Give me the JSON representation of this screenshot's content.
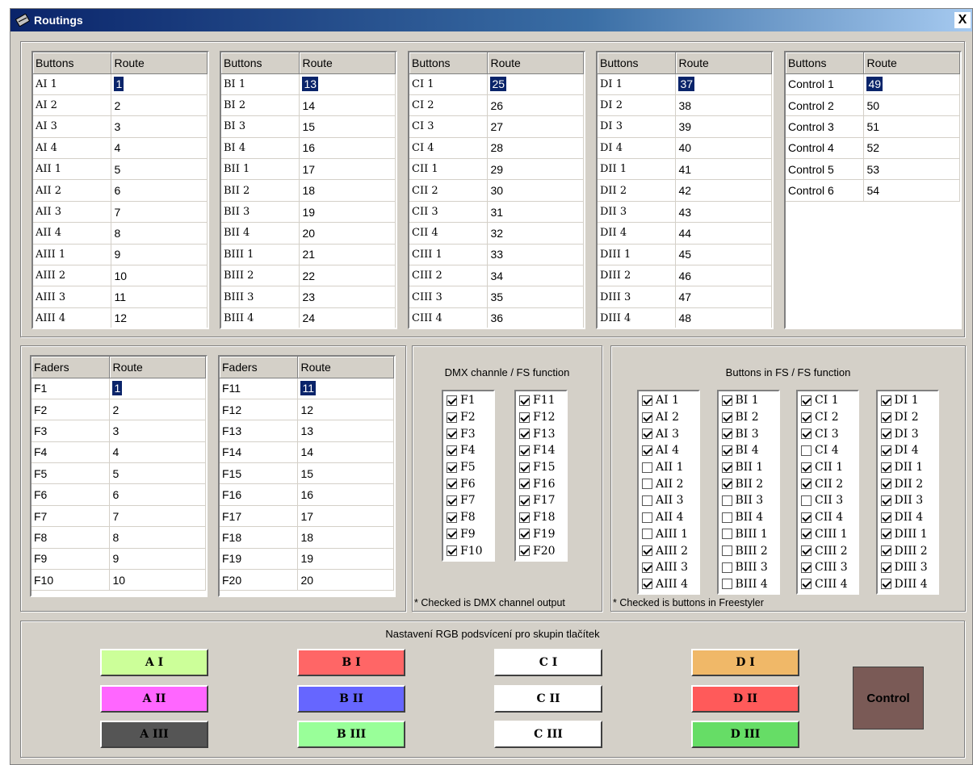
{
  "window": {
    "title": "Routings",
    "close_label": "X"
  },
  "button_grids": [
    {
      "col1": "Buttons",
      "col2": "Route",
      "rows": [
        [
          "AI 1",
          "1"
        ],
        [
          "AI 2",
          "2"
        ],
        [
          "AI 3",
          "3"
        ],
        [
          "AI 4",
          "4"
        ],
        [
          "AII 1",
          "5"
        ],
        [
          "AII 2",
          "6"
        ],
        [
          "AII 3",
          "7"
        ],
        [
          "AII 4",
          "8"
        ],
        [
          "AIII 1",
          "9"
        ],
        [
          "AIII 2",
          "10"
        ],
        [
          "AIII 3",
          "11"
        ],
        [
          "AIII 4",
          "12"
        ]
      ]
    },
    {
      "col1": "Buttons",
      "col2": "Route",
      "rows": [
        [
          "BI 1",
          "13"
        ],
        [
          "BI 2",
          "14"
        ],
        [
          "BI 3",
          "15"
        ],
        [
          "BI 4",
          "16"
        ],
        [
          "BII 1",
          "17"
        ],
        [
          "BII 2",
          "18"
        ],
        [
          "BII 3",
          "19"
        ],
        [
          "BII 4",
          "20"
        ],
        [
          "BIII 1",
          "21"
        ],
        [
          "BIII 2",
          "22"
        ],
        [
          "BIII 3",
          "23"
        ],
        [
          "BIII 4",
          "24"
        ]
      ]
    },
    {
      "col1": "Buttons",
      "col2": "Route",
      "rows": [
        [
          "CI 1",
          "25"
        ],
        [
          "CI 2",
          "26"
        ],
        [
          "CI 3",
          "27"
        ],
        [
          "CI 4",
          "28"
        ],
        [
          "CII 1",
          "29"
        ],
        [
          "CII 2",
          "30"
        ],
        [
          "CII 3",
          "31"
        ],
        [
          "CII 4",
          "32"
        ],
        [
          "CIII 1",
          "33"
        ],
        [
          "CIII 2",
          "34"
        ],
        [
          "CIII 3",
          "35"
        ],
        [
          "CIII 4",
          "36"
        ]
      ]
    },
    {
      "col1": "Buttons",
      "col2": "Route",
      "rows": [
        [
          "DI 1",
          "37"
        ],
        [
          "DI 2",
          "38"
        ],
        [
          "DI 3",
          "39"
        ],
        [
          "DI 4",
          "40"
        ],
        [
          "DII 1",
          "41"
        ],
        [
          "DII 2",
          "42"
        ],
        [
          "DII 3",
          "43"
        ],
        [
          "DII 4",
          "44"
        ],
        [
          "DIII 1",
          "45"
        ],
        [
          "DIII 2",
          "46"
        ],
        [
          "DIII 3",
          "47"
        ],
        [
          "DIII 4",
          "48"
        ]
      ]
    },
    {
      "col1": "Buttons",
      "col2": "Route",
      "rows": [
        [
          "Control 1",
          "49"
        ],
        [
          "Control 2",
          "50"
        ],
        [
          "Control 3",
          "51"
        ],
        [
          "Control 4",
          "52"
        ],
        [
          "Control 5",
          "53"
        ],
        [
          "Control 6",
          "54"
        ]
      ]
    }
  ],
  "fader_grids": [
    {
      "col1": "Faders",
      "col2": "Route",
      "rows": [
        [
          "F1",
          "1"
        ],
        [
          "F2",
          "2"
        ],
        [
          "F3",
          "3"
        ],
        [
          "F4",
          "4"
        ],
        [
          "F5",
          "5"
        ],
        [
          "F6",
          "6"
        ],
        [
          "F7",
          "7"
        ],
        [
          "F8",
          "8"
        ],
        [
          "F9",
          "9"
        ],
        [
          "F10",
          "10"
        ]
      ]
    },
    {
      "col1": "Faders",
      "col2": "Route",
      "rows": [
        [
          "F11",
          "11"
        ],
        [
          "F12",
          "12"
        ],
        [
          "F13",
          "13"
        ],
        [
          "F14",
          "14"
        ],
        [
          "F15",
          "15"
        ],
        [
          "F16",
          "16"
        ],
        [
          "F17",
          "17"
        ],
        [
          "F18",
          "18"
        ],
        [
          "F19",
          "19"
        ],
        [
          "F20",
          "20"
        ]
      ]
    }
  ],
  "dmx": {
    "title": "DMX channle / FS function",
    "note": "* Checked is DMX channel output",
    "lists": [
      [
        [
          "F1",
          true
        ],
        [
          "F2",
          true
        ],
        [
          "F3",
          true
        ],
        [
          "F4",
          true
        ],
        [
          "F5",
          true
        ],
        [
          "F6",
          true
        ],
        [
          "F7",
          true
        ],
        [
          "F8",
          true
        ],
        [
          "F9",
          true
        ],
        [
          "F10",
          true
        ]
      ],
      [
        [
          "F11",
          true
        ],
        [
          "F12",
          true
        ],
        [
          "F13",
          true
        ],
        [
          "F14",
          true
        ],
        [
          "F15",
          true
        ],
        [
          "F16",
          true
        ],
        [
          "F17",
          true
        ],
        [
          "F18",
          true
        ],
        [
          "F19",
          true
        ],
        [
          "F20",
          true
        ]
      ]
    ]
  },
  "fs": {
    "title": "Buttons in FS / FS function",
    "note": "* Checked is buttons in Freestyler",
    "lists": [
      [
        [
          "AI 1",
          true
        ],
        [
          "AI 2",
          true
        ],
        [
          "AI 3",
          true
        ],
        [
          "AI 4",
          true
        ],
        [
          "AII 1",
          false
        ],
        [
          "AII 2",
          false
        ],
        [
          "AII 3",
          false
        ],
        [
          "AII 4",
          false
        ],
        [
          "AIII 1",
          false
        ],
        [
          "AIII 2",
          true
        ],
        [
          "AIII 3",
          true
        ],
        [
          "AIII 4",
          true
        ]
      ],
      [
        [
          "BI 1",
          true
        ],
        [
          "BI 2",
          true
        ],
        [
          "BI 3",
          true
        ],
        [
          "BI 4",
          true
        ],
        [
          "BII 1",
          true
        ],
        [
          "BII 2",
          true
        ],
        [
          "BII 3",
          false
        ],
        [
          "BII 4",
          false
        ],
        [
          "BIII 1",
          false
        ],
        [
          "BIII 2",
          false
        ],
        [
          "BIII 3",
          false
        ],
        [
          "BIII 4",
          false
        ]
      ],
      [
        [
          "CI 1",
          true
        ],
        [
          "CI 2",
          true
        ],
        [
          "CI 3",
          true
        ],
        [
          "CI 4",
          false
        ],
        [
          "CII 1",
          true
        ],
        [
          "CII 2",
          true
        ],
        [
          "CII 3",
          false
        ],
        [
          "CII 4",
          true
        ],
        [
          "CIII 1",
          true
        ],
        [
          "CIII 2",
          true
        ],
        [
          "CIII 3",
          true
        ],
        [
          "CIII 4",
          true
        ]
      ],
      [
        [
          "DI 1",
          true
        ],
        [
          "DI 2",
          true
        ],
        [
          "DI 3",
          true
        ],
        [
          "DI 4",
          true
        ],
        [
          "DII 1",
          true
        ],
        [
          "DII 2",
          true
        ],
        [
          "DII 3",
          true
        ],
        [
          "DII 4",
          true
        ],
        [
          "DIII 1",
          true
        ],
        [
          "DIII 2",
          true
        ],
        [
          "DIII 3",
          true
        ],
        [
          "DIII 4",
          true
        ]
      ]
    ]
  },
  "rgb": {
    "title": "Nastavení RGB podsvícení pro skupin tlačítek",
    "buttons": [
      {
        "label": "A I",
        "color": "#ccff99"
      },
      {
        "label": "A II",
        "color": "#ff66ff"
      },
      {
        "label": "A III",
        "color": "#555555"
      },
      {
        "label": "B I",
        "color": "#ff6666"
      },
      {
        "label": "B II",
        "color": "#6666ff"
      },
      {
        "label": "B III",
        "color": "#99ff99"
      },
      {
        "label": "C I",
        "color": "#ffffff"
      },
      {
        "label": "C II",
        "color": "#ffffff"
      },
      {
        "label": "C III",
        "color": "#ffffff"
      },
      {
        "label": "D I",
        "color": "#f0b868"
      },
      {
        "label": "D II",
        "color": "#ff5a5a"
      },
      {
        "label": "D III",
        "color": "#66dd66"
      }
    ],
    "control": {
      "label": "Control",
      "color": "#7a5a56"
    }
  }
}
